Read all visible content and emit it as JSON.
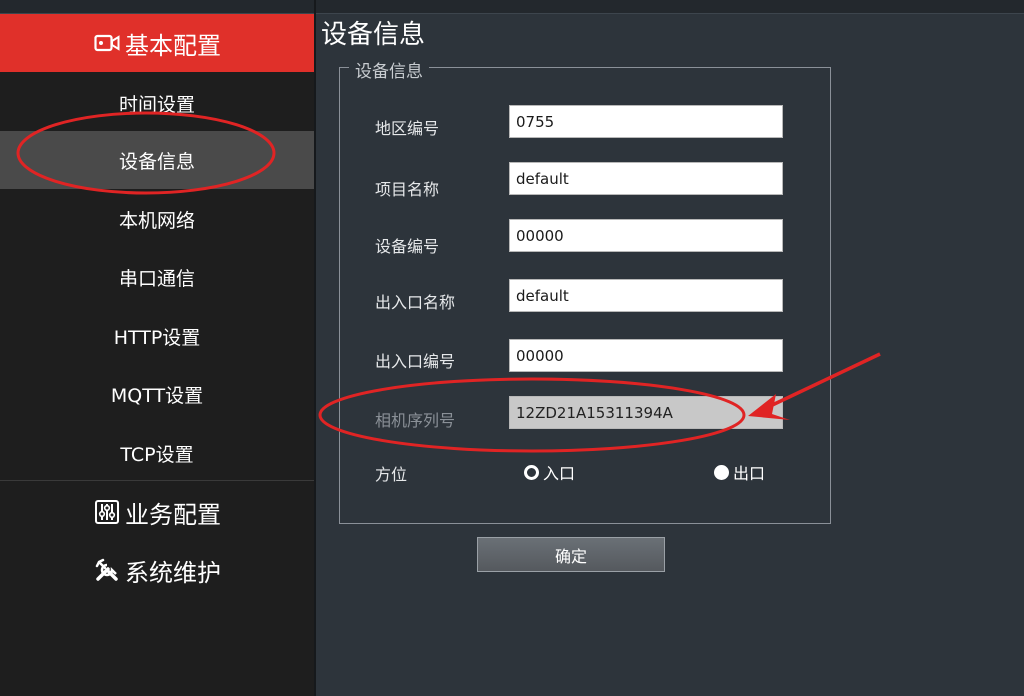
{
  "sidebar": {
    "sections": [
      {
        "label": "基本配置",
        "icon": "video-camera-icon"
      },
      {
        "label": "业务配置",
        "icon": "sliders-icon"
      },
      {
        "label": "系统维护",
        "icon": "wrench-icon"
      }
    ],
    "items": [
      {
        "label": "时间设置"
      },
      {
        "label": "设备信息"
      },
      {
        "label": "本机网络"
      },
      {
        "label": "串口通信"
      },
      {
        "label": "HTTP设置"
      },
      {
        "label": "MQTT设置"
      },
      {
        "label": "TCP设置"
      }
    ]
  },
  "main": {
    "title": "设备信息",
    "group_title": "设备信息",
    "fields": [
      {
        "label": "地区编号",
        "value": "0755"
      },
      {
        "label": "项目名称",
        "value": "default"
      },
      {
        "label": "设备编号",
        "value": "00000"
      },
      {
        "label": "出入口名称",
        "value": "default"
      },
      {
        "label": "出入口编号",
        "value": "00000"
      },
      {
        "label": "相机序列号",
        "value": "12ZD21A15311394A"
      }
    ],
    "direction": {
      "label": "方位",
      "options": [
        "入口",
        "出口"
      ],
      "selected": "入口"
    },
    "confirm_label": "确定"
  },
  "colors": {
    "accent": "#e0302a",
    "annotation": "#e02424",
    "sidebar_bg": "#1e1e1e",
    "content_bg": "#2d343b"
  }
}
